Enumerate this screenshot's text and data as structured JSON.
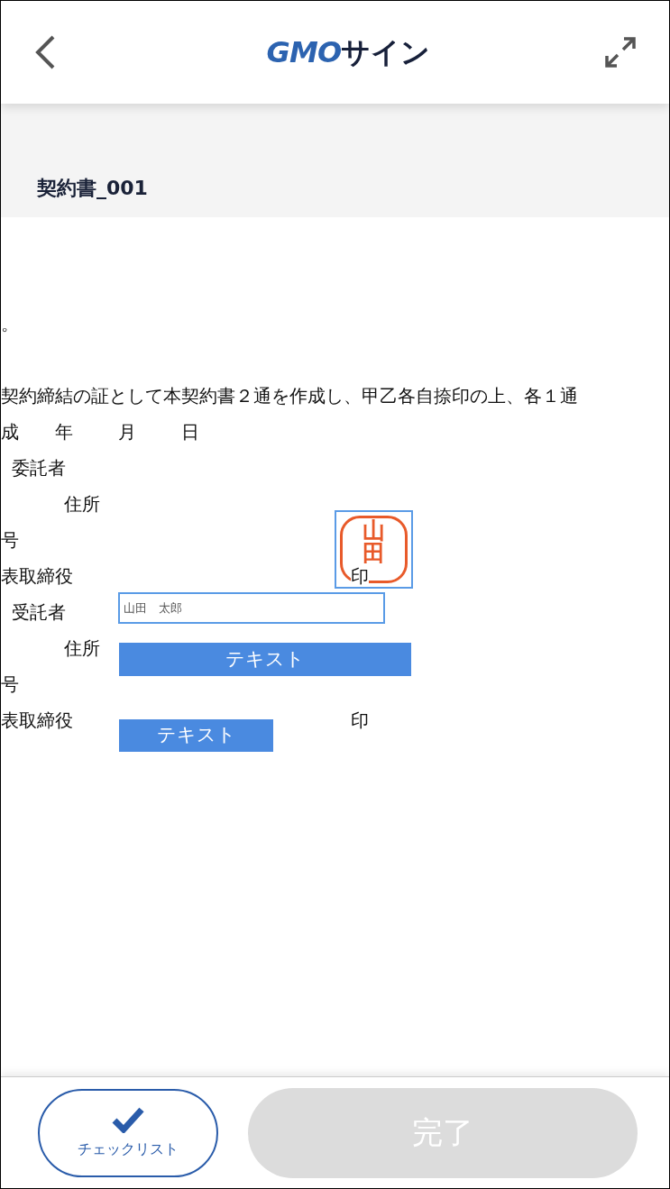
{
  "header": {
    "logo": {
      "latin": "GMO",
      "kana": "サイン"
    }
  },
  "document": {
    "title": "契約書_001",
    "lines": [
      {
        "kind": "text",
        "text": "。"
      },
      {
        "kind": "blank"
      },
      {
        "kind": "text",
        "text": "契約締結の証として本契約書２通を作成し、甲乙各自捺印の上、各１通"
      },
      {
        "kind": "date",
        "parts": [
          "成",
          "年",
          "月",
          "日"
        ]
      },
      {
        "kind": "party",
        "text": "委託者"
      },
      {
        "kind": "address",
        "text": "住所"
      },
      {
        "kind": "text",
        "text": "号"
      },
      {
        "kind": "text",
        "text": "表取締役",
        "seal": "印"
      },
      {
        "kind": "party",
        "text": "受託者"
      },
      {
        "kind": "address",
        "text": "住所"
      },
      {
        "kind": "text",
        "text": "号"
      },
      {
        "kind": "text",
        "text": "表取締役",
        "seal": "印"
      }
    ],
    "fields": [
      {
        "kind": "input",
        "value": "山田　太郎"
      },
      {
        "kind": "text",
        "label": "テキスト"
      },
      {
        "kind": "text_short",
        "label": "テキスト"
      },
      {
        "kind": "stamp",
        "text": "山田"
      }
    ]
  },
  "footer": {
    "checklist": "チェックリスト",
    "done": {
      "label": "完了",
      "disabled": true
    }
  }
}
